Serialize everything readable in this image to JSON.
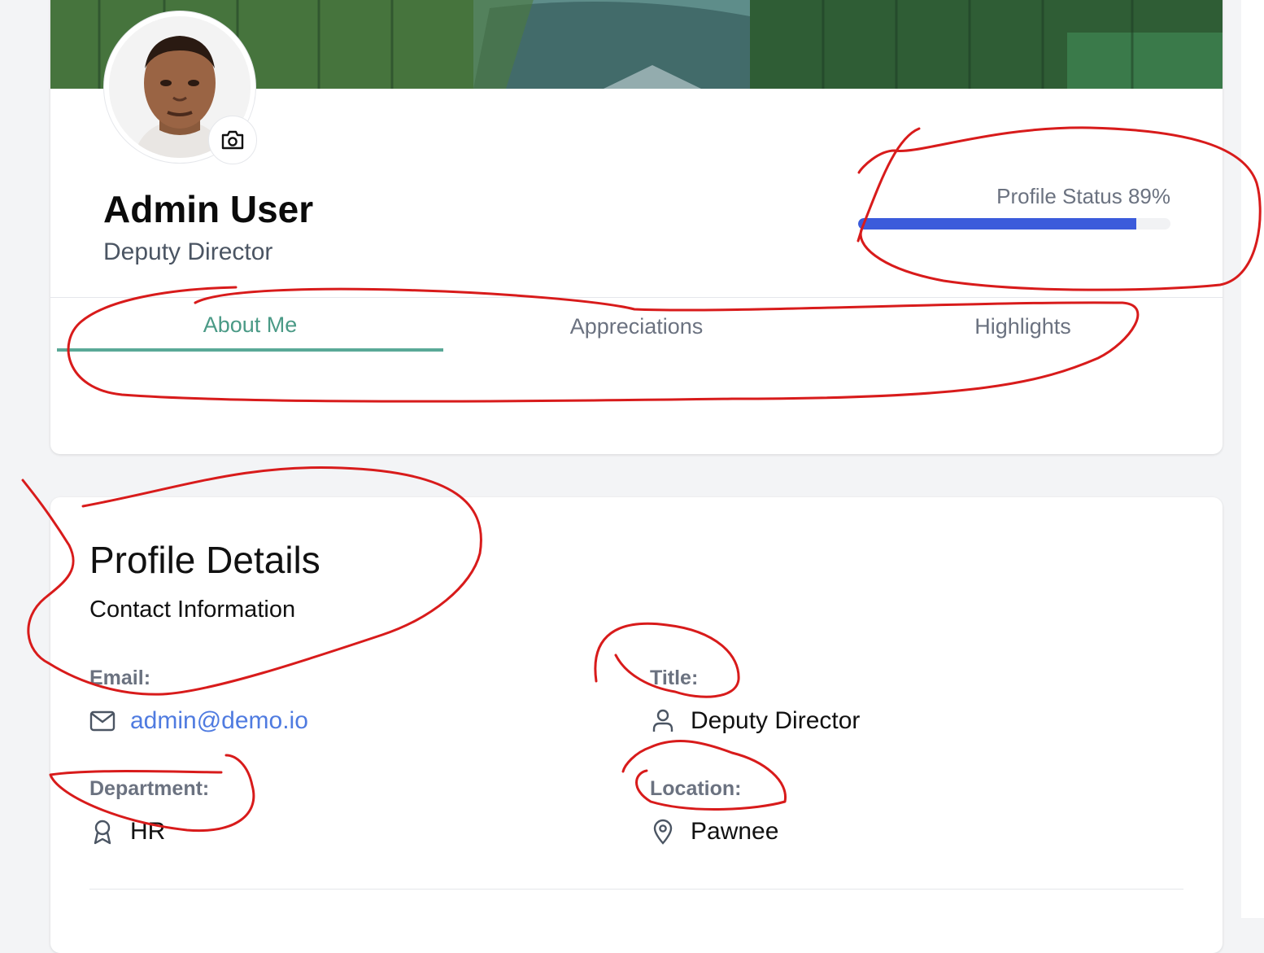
{
  "profile": {
    "name": "Admin User",
    "role": "Deputy Director",
    "avatar_icon": "user-photo",
    "camera_icon": "camera-icon",
    "status": {
      "label": "Profile Status 89%",
      "percent": 89,
      "color": "#3b5bdb"
    }
  },
  "tabs": [
    {
      "label": "About Me",
      "active": true
    },
    {
      "label": "Appreciations",
      "active": false
    },
    {
      "label": "Highlights",
      "active": false
    }
  ],
  "details": {
    "title": "Profile Details",
    "subtitle": "Contact Information",
    "fields": {
      "email": {
        "label": "Email:",
        "value": "admin@demo.io",
        "icon": "mail-icon"
      },
      "title": {
        "label": "Title:",
        "value": "Deputy Director",
        "icon": "user-icon"
      },
      "department": {
        "label": "Department:",
        "value": "HR",
        "icon": "award-icon"
      },
      "location": {
        "label": "Location:",
        "value": "Pawnee",
        "icon": "map-pin-icon"
      }
    }
  },
  "colors": {
    "accent_tab": "#4a9a86",
    "link": "#4f7be0",
    "annotation": "#d81b1b"
  }
}
